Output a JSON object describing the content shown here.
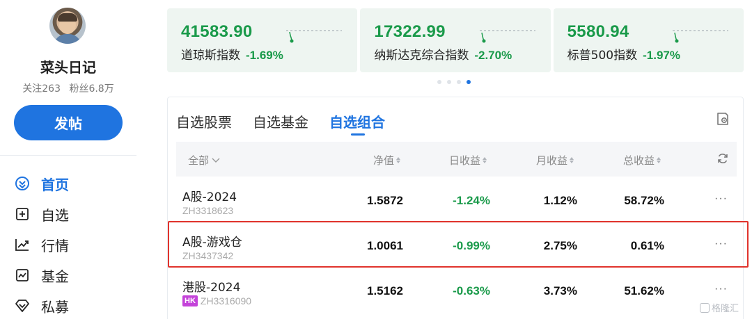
{
  "profile": {
    "username": "菜头日记",
    "following": "关注263",
    "followers": "粉丝6.8万",
    "post_button": "发帖"
  },
  "nav": {
    "items": [
      {
        "label": "首页",
        "icon": "home-icon",
        "active": true
      },
      {
        "label": "自选",
        "icon": "add-box-icon"
      },
      {
        "label": "行情",
        "icon": "trend-chart-icon"
      },
      {
        "label": "基金",
        "icon": "fund-chart-icon"
      },
      {
        "label": "私募",
        "icon": "diamond-icon"
      }
    ]
  },
  "indices": [
    {
      "value": "41583.90",
      "name": "道琼斯指数",
      "change": "-1.69%"
    },
    {
      "value": "17322.99",
      "name": "纳斯达克综合指数",
      "change": "-2.70%"
    },
    {
      "value": "5580.94",
      "name": "标普500指数",
      "change": "-1.97%"
    }
  ],
  "carousel": {
    "count": 4,
    "active_index": 3
  },
  "watchlist": {
    "tabs": [
      {
        "label": "自选股票"
      },
      {
        "label": "自选基金"
      },
      {
        "label": "自选组合",
        "active": true
      }
    ],
    "columns": {
      "all": "全部",
      "nav": "净值",
      "daily": "日收益",
      "monthly": "月收益",
      "total": "总收益"
    },
    "rows": [
      {
        "name": "A股-2024",
        "code": "ZH3318623",
        "badge": "",
        "nav": "1.5872",
        "daily": "-1.24%",
        "monthly": "1.12%",
        "total": "58.72%",
        "more": "···"
      },
      {
        "name": "A股-游戏仓",
        "code": "ZH3437342",
        "badge": "",
        "nav": "1.0061",
        "daily": "-0.99%",
        "monthly": "2.75%",
        "total": "0.61%",
        "more": "···"
      },
      {
        "name": "港股-2024",
        "code": "ZH3316090",
        "badge": "HK",
        "nav": "1.5162",
        "daily": "-0.63%",
        "monthly": "3.73%",
        "total": "51.62%",
        "more": "···"
      }
    ]
  },
  "watermark": "格隆汇",
  "colors": {
    "accent": "#1f74e0",
    "down": "#1a9a4a",
    "highlight": "#e0332c",
    "hk_badge": "#c443d9"
  }
}
